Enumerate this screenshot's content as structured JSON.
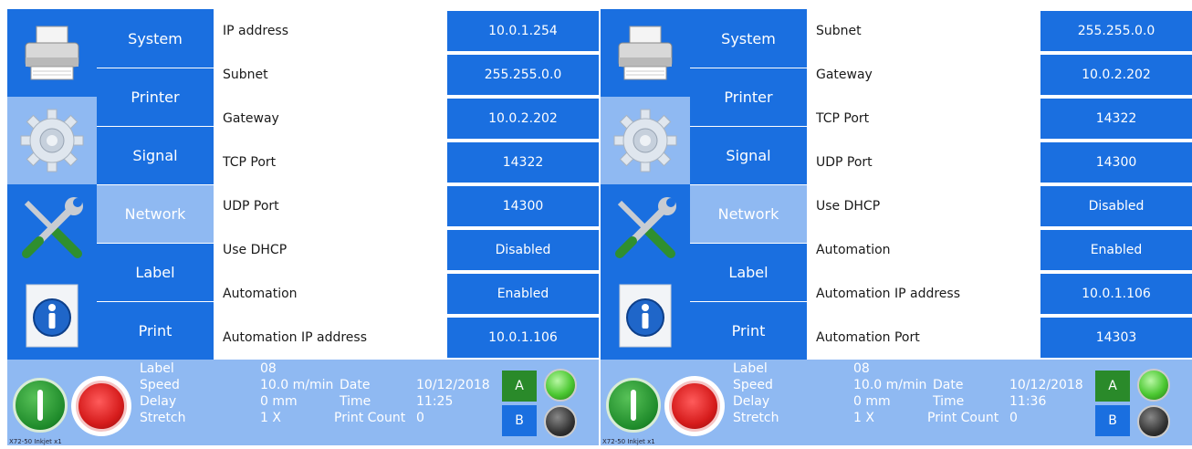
{
  "tabs": [
    "System",
    "Printer",
    "Signal",
    "Network",
    "Label",
    "Print"
  ],
  "active_tab": "Network",
  "icons": [
    "printer-icon",
    "gear-icon",
    "tools-icon",
    "info-icon"
  ],
  "screens": [
    {
      "rows": [
        {
          "label": "IP address",
          "value": "10.0.1.254"
        },
        {
          "label": "Subnet",
          "value": "255.255.0.0"
        },
        {
          "label": "Gateway",
          "value": "10.0.2.202"
        },
        {
          "label": "TCP Port",
          "value": "14322"
        },
        {
          "label": "UDP Port",
          "value": "14300"
        },
        {
          "label": "Use DHCP",
          "value": "Disabled"
        },
        {
          "label": "Automation",
          "value": "Enabled"
        },
        {
          "label": "Automation IP address",
          "value": "10.0.1.106"
        }
      ],
      "status": {
        "label_key": "Label",
        "label_val": "08",
        "speed_key": "Speed",
        "speed_val": "10.0 m/min",
        "delay_key": "Delay",
        "delay_val": "0 mm",
        "stretch_key": "Stretch",
        "stretch_val": "1 X",
        "date_key": "Date",
        "date_val": "10/12/2018",
        "time_key": "Time",
        "time_val": "11:25",
        "count_key": "Print Count",
        "count_val": "0"
      },
      "footer": "X72-50 Inkjet x1",
      "btn_a": "A",
      "btn_b": "B"
    },
    {
      "rows": [
        {
          "label": "Subnet",
          "value": "255.255.0.0"
        },
        {
          "label": "Gateway",
          "value": "10.0.2.202"
        },
        {
          "label": "TCP Port",
          "value": "14322"
        },
        {
          "label": "UDP Port",
          "value": "14300"
        },
        {
          "label": "Use DHCP",
          "value": "Disabled"
        },
        {
          "label": "Automation",
          "value": "Enabled"
        },
        {
          "label": "Automation IP address",
          "value": "10.0.1.106"
        },
        {
          "label": "Automation Port",
          "value": "14303"
        }
      ],
      "status": {
        "label_key": "Label",
        "label_val": "08",
        "speed_key": "Speed",
        "speed_val": "10.0 m/min",
        "delay_key": "Delay",
        "delay_val": "0 mm",
        "stretch_key": "Stretch",
        "stretch_val": "1 X",
        "date_key": "Date",
        "date_val": "10/12/2018",
        "time_key": "Time",
        "time_val": "11:36",
        "count_key": "Print Count",
        "count_val": "0"
      },
      "footer": "X72-50 Inkjet x1",
      "btn_a": "A",
      "btn_b": "B"
    }
  ],
  "colors": {
    "primary": "#1a6fe0",
    "light": "#8fb9f2",
    "start_green": "#1e8a2a",
    "stop_red": "#d61c1c"
  }
}
